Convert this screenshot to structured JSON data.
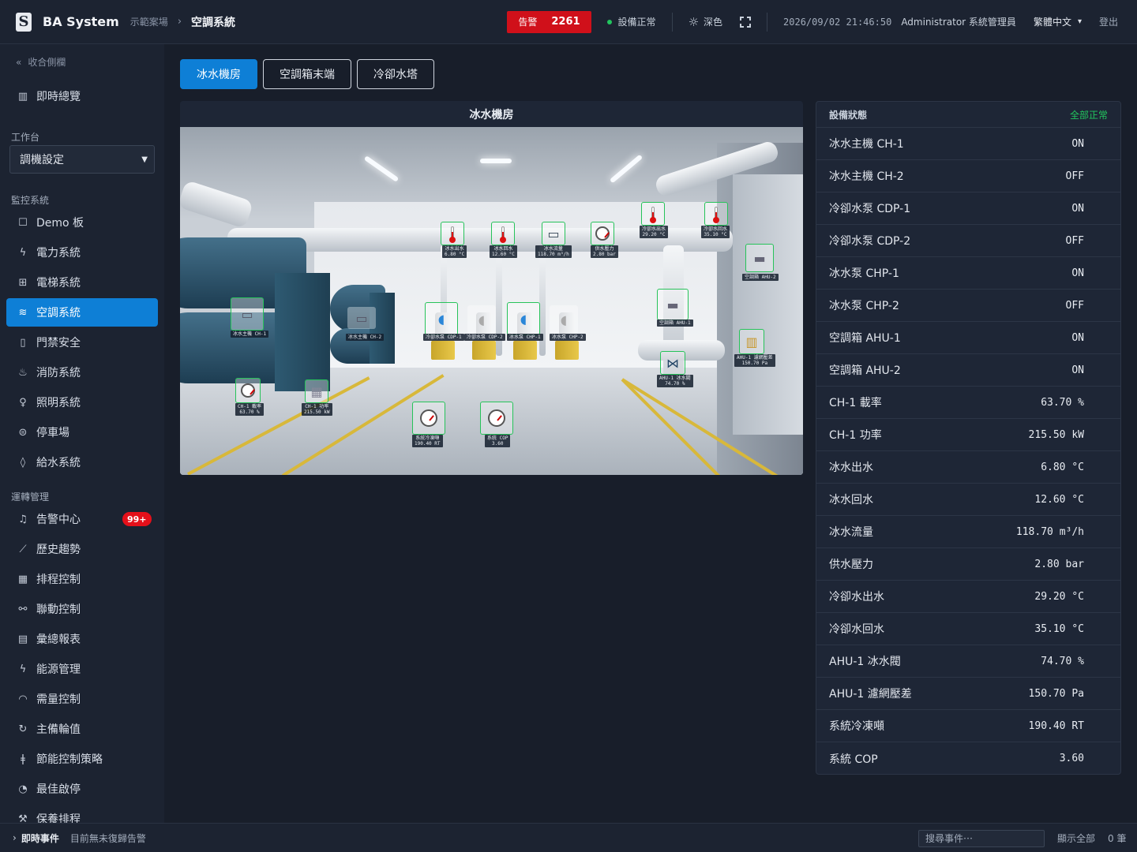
{
  "header": {
    "app_title": "BA System",
    "breadcrumb_site": "示範案場",
    "breadcrumb_sep": "›",
    "breadcrumb_current": "空調系統",
    "alarm_label": "告警",
    "alarm_count": "2261",
    "device_status": "設備正常",
    "theme_label": "深色",
    "datetime": "2026/09/02 21:46:50",
    "user": "Administrator 系統管理員",
    "language": "繁體中文",
    "logout": "登出"
  },
  "sidebar": {
    "collapse_label": "收合側欄",
    "overview": "即時總覽",
    "workspace_label": "工作台",
    "workspace_value": "調機設定",
    "monitor_label": "監控系統",
    "monitor_items": [
      "Demo 板",
      "電力系統",
      "電梯系統",
      "空調系統",
      "門禁安全",
      "消防系統",
      "照明系統",
      "停車場",
      "給水系統"
    ],
    "ops_label": "運轉管理",
    "ops_items": [
      "告警中心",
      "歷史趨勢",
      "排程控制",
      "聯動控制",
      "彙總報表",
      "能源管理",
      "需量控制",
      "主備輪值",
      "節能控制策略",
      "最佳啟停",
      "保養排程"
    ],
    "alarm_center_badge": "99+"
  },
  "tabs": [
    "冰水機房",
    "空調箱末端",
    "冷卻水塔"
  ],
  "scene": {
    "title": "冰水機房",
    "tags": {
      "chw_out": [
        "冰水出水",
        "6.80 °C"
      ],
      "chw_ret": [
        "冰水回水",
        "12.60 °C"
      ],
      "chw_flow": [
        "冰水流量",
        "118.70 m³/h"
      ],
      "supply_p": [
        "供水壓力",
        "2.80 bar"
      ],
      "cw_out": [
        "冷卻水出水",
        "29.20 °C"
      ],
      "cw_ret": [
        "冷卻水回水",
        "35.10 °C"
      ],
      "ahu2": [
        "空調箱 AHU-2",
        ""
      ],
      "ahu1": [
        "空調箱 AHU-1",
        ""
      ],
      "ahu1_filter": [
        "AHU-1 濾網壓差",
        "150.70 Pa"
      ],
      "ahu1_valve": [
        "AHU-1 冰水閥",
        "74.70 %"
      ],
      "ch1": [
        "冰水主機 CH-1",
        ""
      ],
      "ch2": [
        "冰水主機 CH-2",
        ""
      ],
      "cdp1": [
        "冷卻水泵 CDP-1",
        ""
      ],
      "cdp2": [
        "冷卻水泵 CDP-2",
        ""
      ],
      "chp1": [
        "冰水泵 CHP-1",
        ""
      ],
      "chp2": [
        "冰水泵 CHP-2",
        ""
      ],
      "ch1_load": [
        "CH-1 載率",
        "63.70 %"
      ],
      "ch1_power": [
        "CH-1 功率",
        "215.50 kW"
      ],
      "sys_rt": [
        "系統冷凍噸",
        "190.40 RT"
      ],
      "sys_cop": [
        "系統 COP",
        "3.60"
      ]
    }
  },
  "status_panel": {
    "title": "設備狀態",
    "summary": "全部正常",
    "rows": [
      {
        "label": "冰水主機 CH-1",
        "value": "ON"
      },
      {
        "label": "冰水主機 CH-2",
        "value": "OFF"
      },
      {
        "label": "冷卻水泵 CDP-1",
        "value": "ON"
      },
      {
        "label": "冷卻水泵 CDP-2",
        "value": "OFF"
      },
      {
        "label": "冰水泵 CHP-1",
        "value": "ON"
      },
      {
        "label": "冰水泵 CHP-2",
        "value": "OFF"
      },
      {
        "label": "空調箱 AHU-1",
        "value": "ON"
      },
      {
        "label": "空調箱 AHU-2",
        "value": "ON"
      },
      {
        "label": "CH-1 載率",
        "value": "63.70 %"
      },
      {
        "label": "CH-1 功率",
        "value": "215.50 kW"
      },
      {
        "label": "冰水出水",
        "value": "6.80 °C"
      },
      {
        "label": "冰水回水",
        "value": "12.60 °C"
      },
      {
        "label": "冰水流量",
        "value": "118.70 m³/h"
      },
      {
        "label": "供水壓力",
        "value": "2.80 bar"
      },
      {
        "label": "冷卻水出水",
        "value": "29.20 °C"
      },
      {
        "label": "冷卻水回水",
        "value": "35.10 °C"
      },
      {
        "label": "AHU-1 冰水閥",
        "value": "74.70 %"
      },
      {
        "label": "AHU-1 濾網壓差",
        "value": "150.70 Pa"
      },
      {
        "label": "系統冷凍噸",
        "value": "190.40 RT"
      },
      {
        "label": "系統 COP",
        "value": "3.60"
      }
    ]
  },
  "bottom": {
    "arrow": "›",
    "label": "即時事件",
    "message": "目前無未復歸告警",
    "search_placeholder": "搜尋事件⋯",
    "show_all": "顯示全部",
    "count": "0 筆"
  },
  "colors": {
    "accent": "#0e7fd6",
    "alarm": "#d0101a",
    "ok": "#22c55e"
  }
}
